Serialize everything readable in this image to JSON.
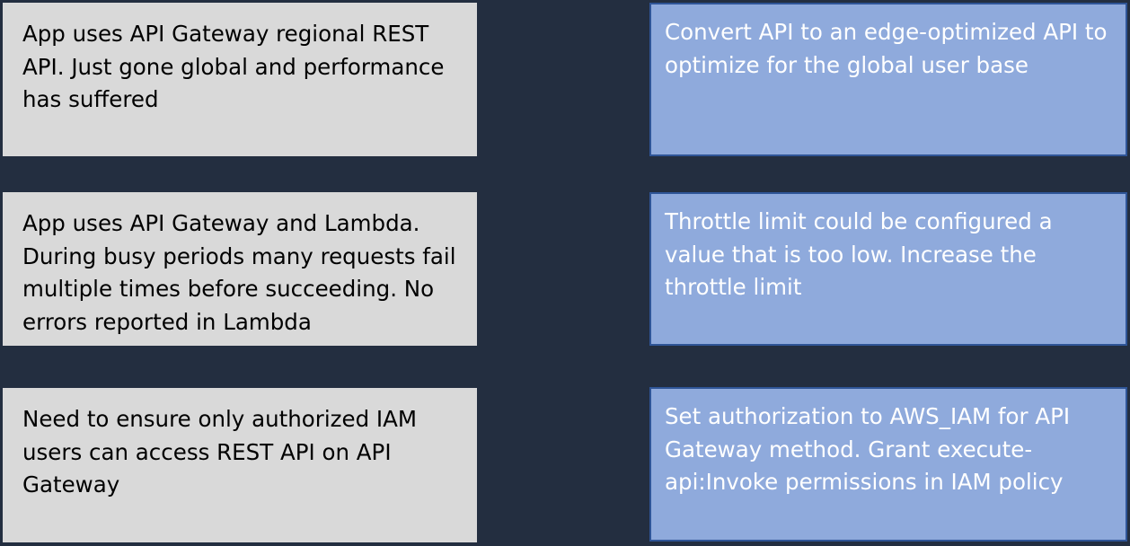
{
  "colors": {
    "background": "#232e40",
    "scenario_fill": "#d9d9d9",
    "solution_fill": "#8faadc",
    "solution_border": "#2f5597"
  },
  "rows": [
    {
      "scenario": "App uses API Gateway regional REST API. Just gone global and performance has suffered",
      "solution": "Convert API to an edge-optimized API to optimize for the global user base"
    },
    {
      "scenario": "App uses API Gateway and Lambda. During busy periods many requests fail multiple times before succeeding. No errors reported in Lambda",
      "solution": "Throttle limit could be configured a value that is too low. Increase the throttle limit"
    },
    {
      "scenario": "Need to ensure only authorized IAM users can access REST API on API Gateway",
      "solution": "Set authorization to AWS_IAM for API Gateway method. Grant execute-api:Invoke permissions in IAM policy"
    }
  ]
}
